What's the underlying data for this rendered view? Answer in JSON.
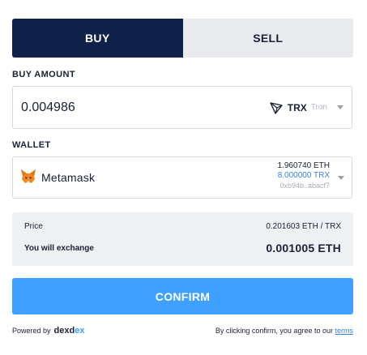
{
  "tabs": {
    "buy": "BUY",
    "sell": "SELL",
    "active": "buy"
  },
  "buy_amount": {
    "label": "BUY AMOUNT",
    "value": "0.004986",
    "token": {
      "symbol": "TRX",
      "name": "Tron",
      "icon": "tron-icon"
    }
  },
  "wallet": {
    "label": "WALLET",
    "name": "Metamask",
    "icon": "metamask-fox-icon",
    "balance_eth": "1.960740 ETH",
    "balance_trx": "8.000000 TRX",
    "address": "0xb94b..abacf7"
  },
  "summary": {
    "price_label": "Price",
    "price_value": "0.201603 ETH / TRX",
    "exchange_label": "You will exchange",
    "exchange_value": "0.001005 ETH"
  },
  "confirm_label": "CONFIRM",
  "footer": {
    "powered_by": "Powered by",
    "brand_start": "dexd",
    "brand_accent": "ex",
    "agree_text": "By clicking confirm, you agree to our",
    "terms_link": "terms"
  },
  "colors": {
    "primary_dark": "#10214a",
    "accent": "#3fa0ff",
    "trx_link": "#3b82d6"
  }
}
